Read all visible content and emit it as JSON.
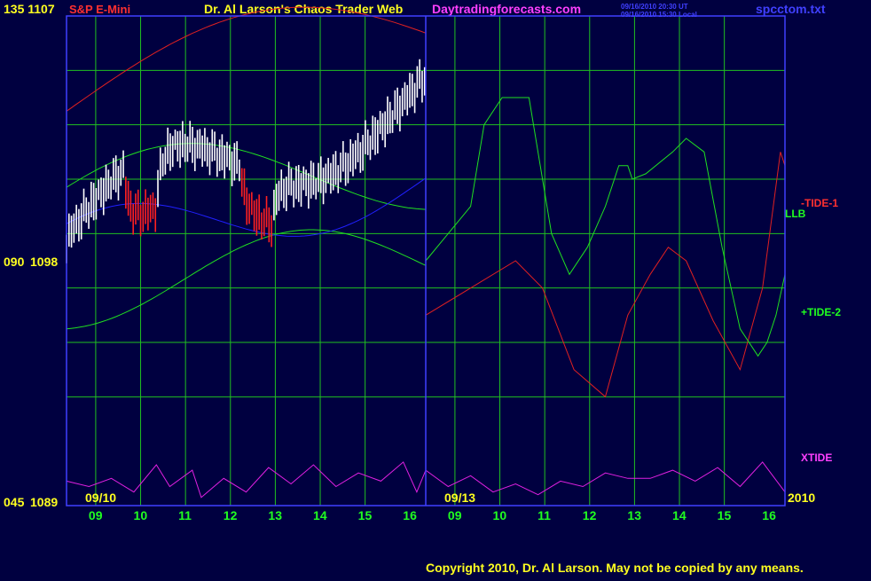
{
  "header": {
    "left_axis_label": "135  1107",
    "instrument": "S&P E-Mini",
    "main_title": "Dr. Al Larson's Chaos Trader Web",
    "site": "Daytradingforecasts.com",
    "timestamp_ut": "09/16/2010 20:30 UT",
    "timestamp_local": "09/16/2010 15:30 Local",
    "filename": "spcctom.txt"
  },
  "footer": {
    "copyright": "Copyright 2010, Dr. Al Larson. May not be copied by any means."
  },
  "colors": {
    "background": "#000040",
    "frame": "#4040ff",
    "grid": "#20c020",
    "price_up": "#ffffff",
    "price_down": "#ff2020",
    "channel": "#e02020",
    "band": "#20e020",
    "moving_avg": "#2020ff",
    "tide1": "#e02020",
    "tide2": "#20e020",
    "xtide": "#e020e0",
    "label_yellow": "#ffff20",
    "label_green": "#20ff20",
    "label_red": "#ff3030",
    "label_magenta": "#ff40ff"
  },
  "chart_data": {
    "type": "line",
    "x_unit": "trading day (fractional)",
    "x_range": [
      0,
      16
    ],
    "price_ylim": [
      1089,
      1107
    ],
    "left_axis": [
      {
        "osc": "135",
        "price": "1107"
      },
      {
        "osc": "090",
        "price": "1098"
      },
      {
        "osc": "045",
        "price": "1089"
      }
    ],
    "x_ticks": [
      "09",
      "10",
      "11",
      "12",
      "13",
      "14",
      "15",
      "16",
      "09",
      "10",
      "11",
      "12",
      "13",
      "14",
      "15",
      "16"
    ],
    "date_labels": [
      "09/10",
      "09/13"
    ],
    "year_label": "2010",
    "annotations": [
      "-TIDE-1",
      "LLB",
      "+TIDE-2",
      "XTIDE"
    ],
    "series": [
      {
        "name": "-TIDE-1",
        "points": [
          [
            8,
            1096
          ],
          [
            9,
            1097
          ],
          [
            10,
            1098
          ],
          [
            10.6,
            1097
          ],
          [
            11.3,
            1094
          ],
          [
            12,
            1093
          ],
          [
            12.5,
            1096
          ],
          [
            13,
            1097.5
          ],
          [
            13.4,
            1098.5
          ],
          [
            13.8,
            1098
          ],
          [
            14.4,
            1095.8
          ],
          [
            15,
            1094
          ],
          [
            15.5,
            1097
          ],
          [
            15.9,
            1102
          ],
          [
            16,
            1101.5
          ]
        ]
      },
      {
        "name": "+TIDE-2",
        "points": [
          [
            8,
            1098
          ],
          [
            9,
            1100
          ],
          [
            9.3,
            1103
          ],
          [
            9.7,
            1104
          ],
          [
            10.3,
            1104
          ],
          [
            10.8,
            1099
          ],
          [
            11.2,
            1097.5
          ],
          [
            11.6,
            1098.5
          ],
          [
            12,
            1100
          ],
          [
            12.3,
            1101.5
          ],
          [
            12.5,
            1101.5
          ],
          [
            12.6,
            1101
          ],
          [
            12.9,
            1101.2
          ],
          [
            13.5,
            1102
          ],
          [
            13.8,
            1102.5
          ],
          [
            14.2,
            1102
          ],
          [
            14.6,
            1098.5
          ],
          [
            15,
            1095.5
          ],
          [
            15.4,
            1094.5
          ],
          [
            15.6,
            1095
          ],
          [
            15.8,
            1096
          ],
          [
            16,
            1097.5
          ]
        ]
      },
      {
        "name": "XTIDE",
        "osc_points": [
          [
            0,
            54
          ],
          [
            0.5,
            52
          ],
          [
            1,
            55
          ],
          [
            1.5,
            50
          ],
          [
            2,
            60
          ],
          [
            2.3,
            52
          ],
          [
            2.8,
            58
          ],
          [
            3,
            48
          ],
          [
            3.5,
            55
          ],
          [
            4,
            50
          ],
          [
            4.5,
            59
          ],
          [
            5,
            53
          ],
          [
            5.5,
            60
          ],
          [
            6,
            52
          ],
          [
            6.5,
            57
          ],
          [
            7,
            54
          ],
          [
            7.5,
            61
          ],
          [
            7.8,
            50
          ],
          [
            8,
            58
          ],
          [
            8.5,
            52
          ],
          [
            9,
            56
          ],
          [
            9.5,
            50
          ],
          [
            10,
            53
          ],
          [
            10.5,
            49
          ],
          [
            11,
            54
          ],
          [
            11.5,
            52
          ],
          [
            12,
            57
          ],
          [
            12.5,
            55
          ],
          [
            13,
            55
          ],
          [
            13.5,
            58
          ],
          [
            14,
            54
          ],
          [
            14.5,
            59
          ],
          [
            15,
            52
          ],
          [
            15.5,
            61
          ],
          [
            16,
            50
          ]
        ]
      }
    ]
  }
}
